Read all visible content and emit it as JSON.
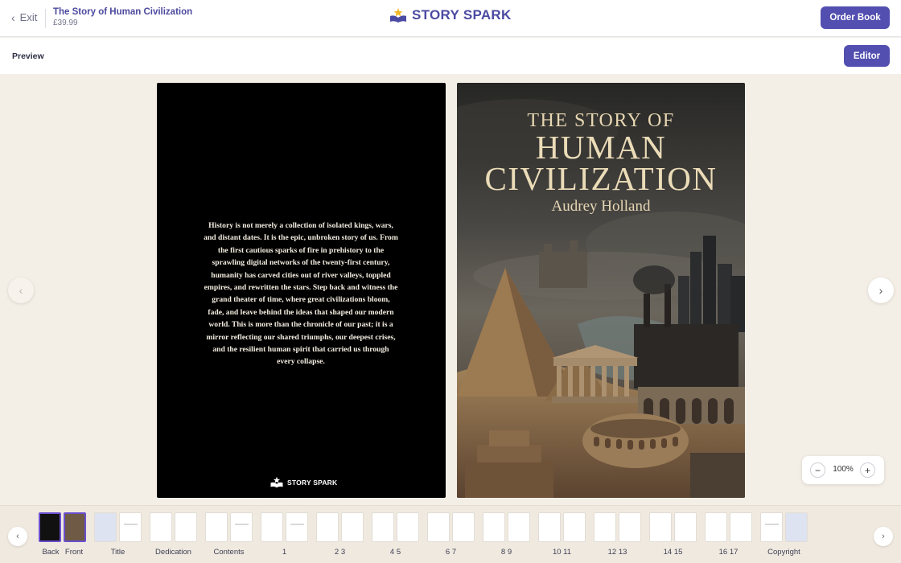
{
  "header": {
    "exit_label": "Exit",
    "book_title": "The Story of Human Civilization",
    "price": "£39.99",
    "logo_text": "STORY SPARK",
    "order_button": "Order Book"
  },
  "toolbar": {
    "preview_label": "Preview",
    "editor_button": "Editor"
  },
  "back_cover": {
    "blurb": "History is not merely a collection of isolated kings, wars, and distant dates. It is the epic, unbroken story of us. From the first cautious sparks of fire in prehistory to the sprawling digital networks of the twenty-first century, humanity has carved cities out of river valleys, toppled empires, and rewritten the stars. Step back and witness the grand theater of time, where great civilizations bloom, fade, and leave behind the ideas that shaped our modern world. This is more than the chronicle of our past; it is a mirror reflecting our shared triumphs, our deepest crises, and the resilient human spirit that carried us through every collapse.",
    "logo_text": "STORY SPARK"
  },
  "front_cover": {
    "title_line1": "THE STORY OF",
    "title_line2": "HUMAN",
    "title_line3": "CIVILIZATION",
    "author": "Audrey Holland"
  },
  "zoom": {
    "value": "100%",
    "minus": "−",
    "plus": "+"
  },
  "nav": {
    "prev": "‹",
    "next": "›"
  },
  "thumbnails": {
    "labels": [
      "Back",
      "Front",
      "Title",
      "Dedication",
      "Contents",
      "1",
      "2 3",
      "4 5",
      "6 7",
      "8 9",
      "10 11",
      "12 13",
      "14 15",
      "16 17",
      "Copyright"
    ]
  },
  "colors": {
    "accent": "#524fb0",
    "background": "#f4efe6",
    "selected_thumb": "#6b4fd0"
  },
  "icons": [
    "chevron-left-icon",
    "chevron-right-icon",
    "story-spark-logo-icon",
    "minus-icon",
    "plus-icon"
  ]
}
